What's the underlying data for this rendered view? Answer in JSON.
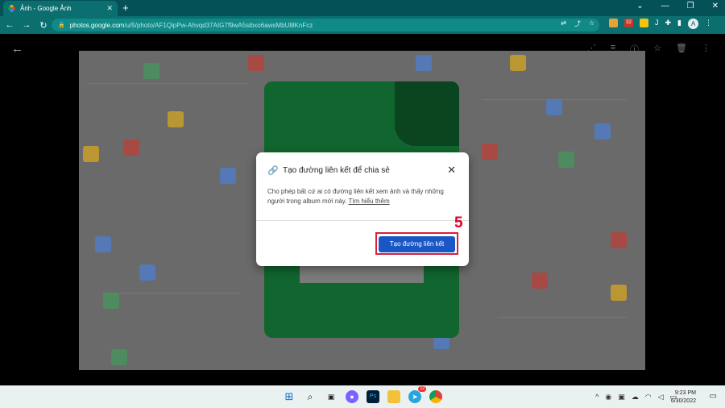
{
  "browser": {
    "tab_title": "Ảnh - Google Ảnh",
    "new_tab": "+",
    "close_tab": "✕",
    "url_domain": "photos.google.com",
    "url_path": "/u/5/photo/AF1QipPw-Ahvqd37AIG7f9wA5sibxo6awsMbUl8KnFcz",
    "avatar_letter": "A",
    "ext_badge": "32"
  },
  "dialog": {
    "title": "Tạo đường liên kết để chia sẻ",
    "body": "Cho phép bất cứ ai có đường liên kết xem ảnh và thấy những người trong album mới này.",
    "learn_more": "Tìm hiểu thêm",
    "create_button": "Tạo đường liên kết"
  },
  "annotation": {
    "step": "5",
    "color": "#e4002b"
  },
  "taskbar": {
    "time": "9:23 PM",
    "date": "6/30/2022",
    "telegram_badge": "12"
  },
  "colors": {
    "chrome_tab": "#055158",
    "chrome_toolbar": "#0b6e6f",
    "button_blue": "#1a56c4"
  }
}
